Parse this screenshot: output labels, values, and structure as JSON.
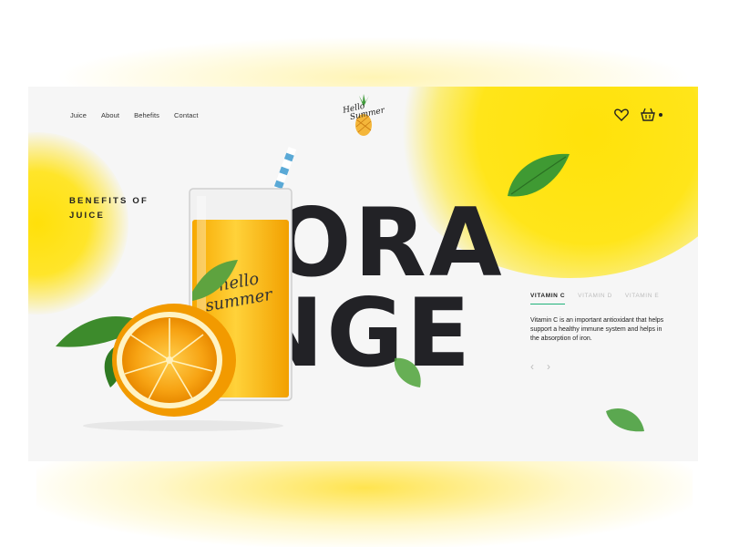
{
  "nav": {
    "items": [
      "Juice",
      "About",
      "Behefits",
      "Contact"
    ]
  },
  "logo": {
    "text_line1": "Hello",
    "text_line2": "Summer"
  },
  "header": {
    "icons": [
      "heart-icon",
      "basket-icon"
    ]
  },
  "hero": {
    "line1": "BENEFITS OF",
    "line2": "JUICE",
    "word_top": "ORA",
    "word_bottom": "NGE",
    "glass_text_1": "hello",
    "glass_text_2": "summer"
  },
  "vitamins": {
    "tabs": [
      {
        "label": "VITAMIN C",
        "active": true
      },
      {
        "label": "VITAMIN D",
        "active": false
      },
      {
        "label": "VITAMIN E",
        "active": false
      }
    ],
    "description": "Vitamin C is an important antioxidant that helps support a healthy immune system and helps in the absorption of iron."
  },
  "slider": {
    "prev_icon": "chevron-left-icon",
    "next_icon": "chevron-right-icon"
  },
  "colors": {
    "accent_yellow": "#ffe20a",
    "orange": "#f7a313",
    "tab_underline": "#20b37a",
    "text_dark": "#222226",
    "background": "#f6f6f6"
  }
}
